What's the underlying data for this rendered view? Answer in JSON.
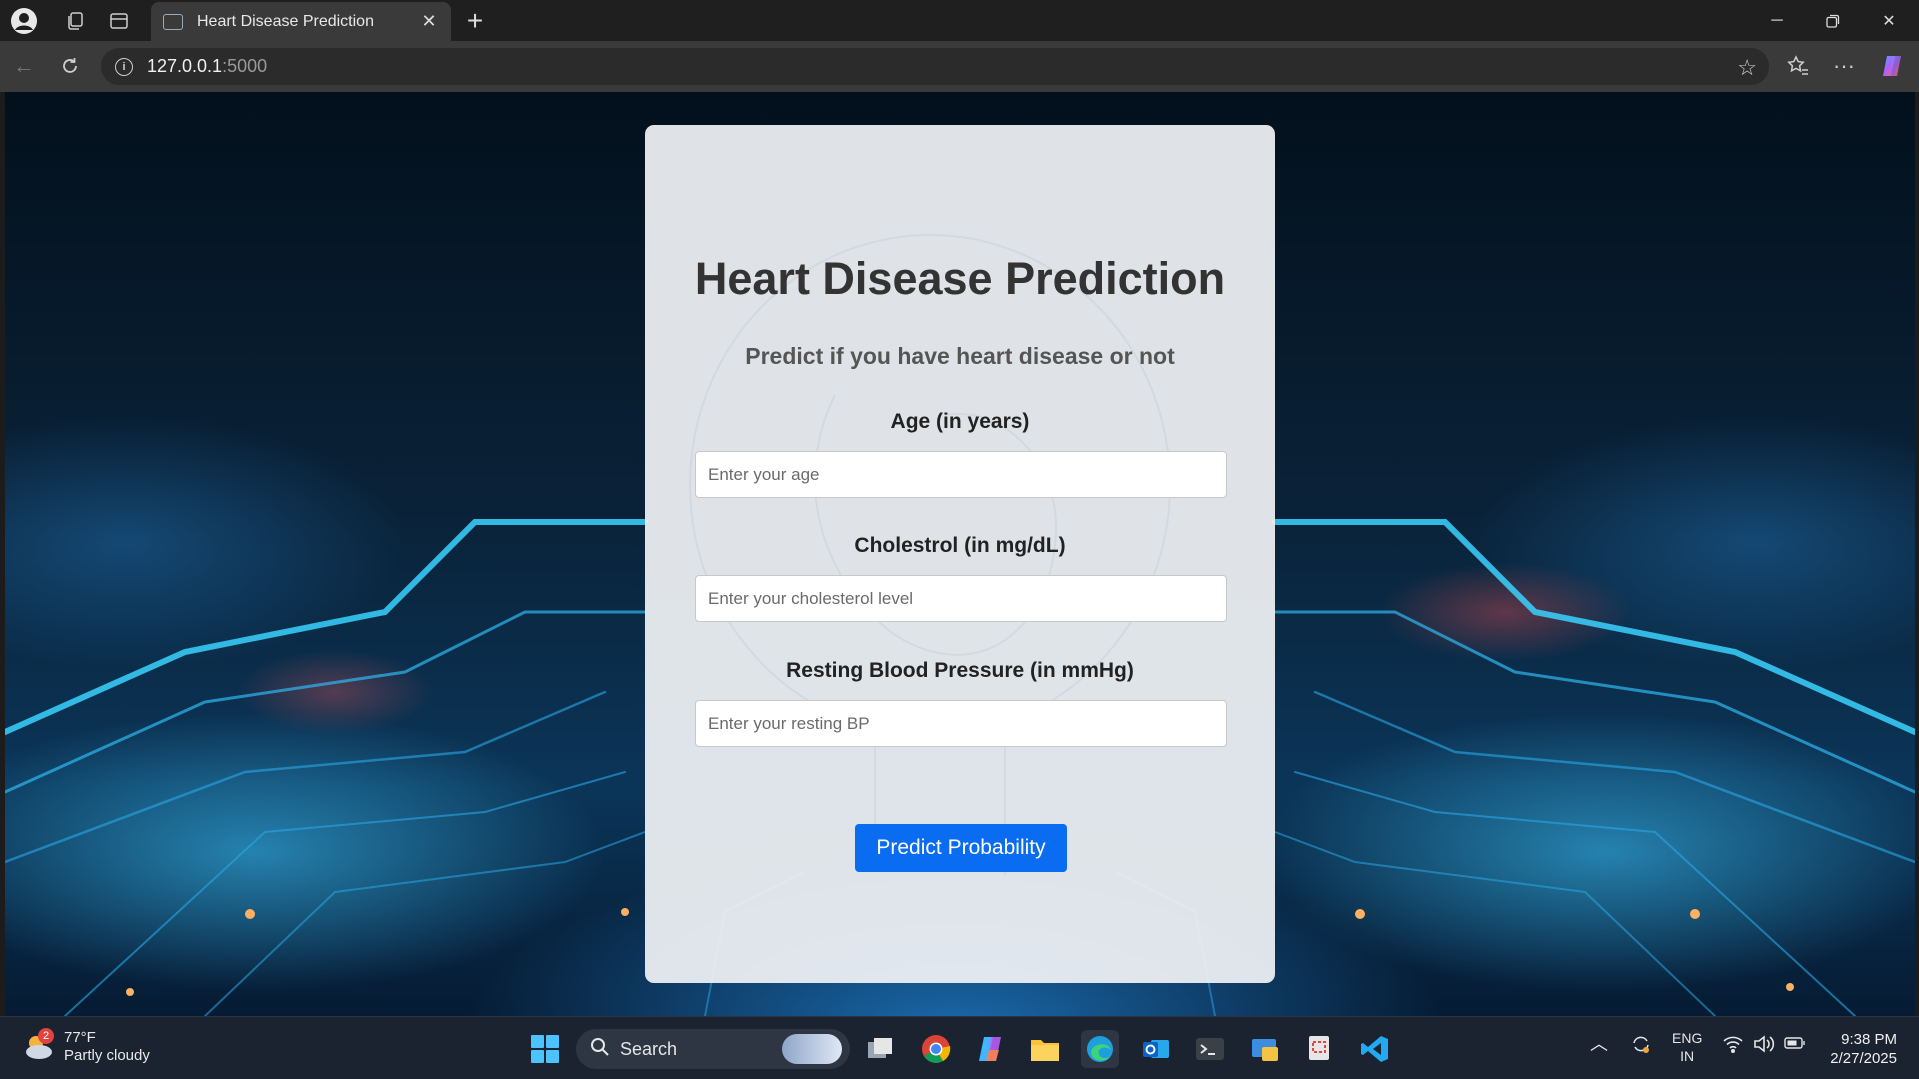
{
  "browser": {
    "tab_title": "Heart Disease Prediction",
    "url_host": "127.0.0.1",
    "url_port": ":5000"
  },
  "page": {
    "title": "Heart Disease Prediction",
    "subtitle": "Predict if you have heart disease or not",
    "fields": [
      {
        "label": "Age (in years)",
        "placeholder": "Enter your age"
      },
      {
        "label": "Cholestrol (in mg/dL)",
        "placeholder": "Enter your cholesterol level"
      },
      {
        "label": "Resting Blood Pressure (in mmHg)",
        "placeholder": "Enter your resting BP"
      }
    ],
    "submit_label": "Predict Probability",
    "accent_color": "#0a6cf0"
  },
  "taskbar": {
    "weather_badge": "2",
    "weather_temp": "77°F",
    "weather_condition": "Partly cloudy",
    "search_label": "Search",
    "language_top": "ENG",
    "language_bottom": "IN",
    "time": "9:38 PM",
    "date": "2/27/2025"
  }
}
